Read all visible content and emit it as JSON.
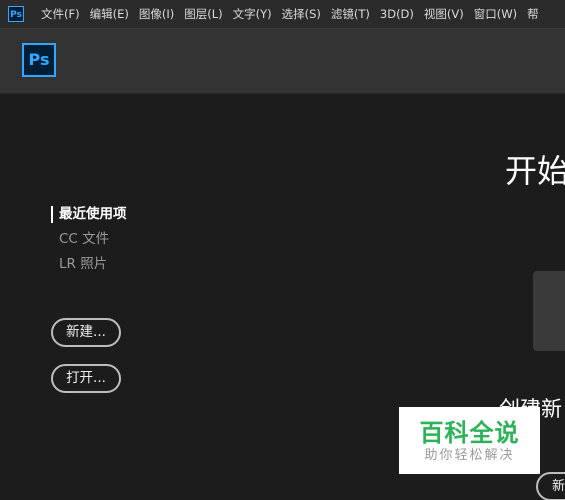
{
  "menubar": {
    "app_icon": "Ps",
    "items": [
      {
        "label": "文件(F)"
      },
      {
        "label": "编辑(E)"
      },
      {
        "label": "图像(I)"
      },
      {
        "label": "图层(L)"
      },
      {
        "label": "文字(Y)"
      },
      {
        "label": "选择(S)"
      },
      {
        "label": "滤镜(T)"
      },
      {
        "label": "3D(D)"
      },
      {
        "label": "视图(V)"
      },
      {
        "label": "窗口(W)"
      },
      {
        "label": "帮"
      }
    ]
  },
  "header": {
    "logo": "Ps"
  },
  "nav": {
    "items": [
      {
        "label": "最近使用项",
        "active": true
      },
      {
        "label": "CC 文件",
        "active": false
      },
      {
        "label": "LR 照片",
        "active": false
      }
    ]
  },
  "actions": {
    "new_label": "新建...",
    "open_label": "打开..."
  },
  "main": {
    "start_title": "开始",
    "create_new_title": "创建新",
    "new_button_label": "新"
  },
  "watermark": {
    "main": "百科全说",
    "sub": "助你轻松解决"
  },
  "colors": {
    "ps_blue": "#31a8ff",
    "ps_dark": "#001e36",
    "background": "#1c1c1c",
    "watermark_green": "#2cb357"
  }
}
